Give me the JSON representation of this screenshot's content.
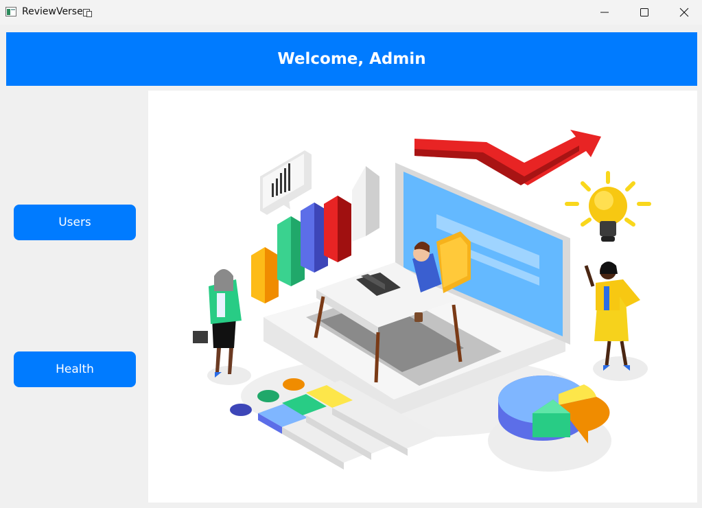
{
  "window": {
    "title": "ReviewVerse",
    "controls": [
      "minimize",
      "maximize",
      "close"
    ]
  },
  "header": {
    "welcome": "Welcome, Admin"
  },
  "sidebar": {
    "items": [
      {
        "label": "Users"
      },
      {
        "label": "Health"
      }
    ]
  },
  "colors": {
    "primary": "#007bff",
    "window_bg": "#f0f0f0",
    "content_bg": "#ffffff"
  },
  "illustration": {
    "icon": "business-analytics-illustration"
  }
}
